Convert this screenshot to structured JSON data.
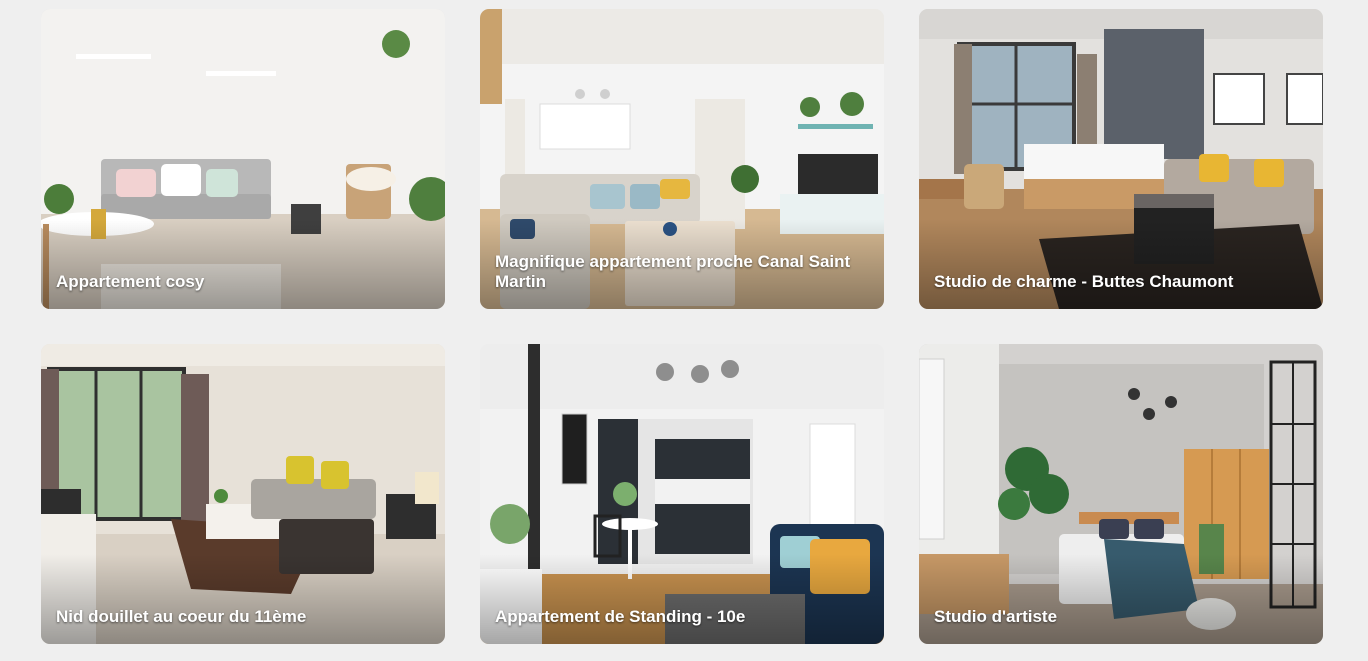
{
  "listings": [
    {
      "title": "Appartement cosy"
    },
    {
      "title": "Magnifique appartement proche Canal Saint Martin"
    },
    {
      "title": "Studio de charme - Buttes Chaumont"
    },
    {
      "title": "Nid douillet au coeur du 11ème"
    },
    {
      "title": "Appartement de Standing - 10e"
    },
    {
      "title": "Studio d'artiste"
    }
  ]
}
